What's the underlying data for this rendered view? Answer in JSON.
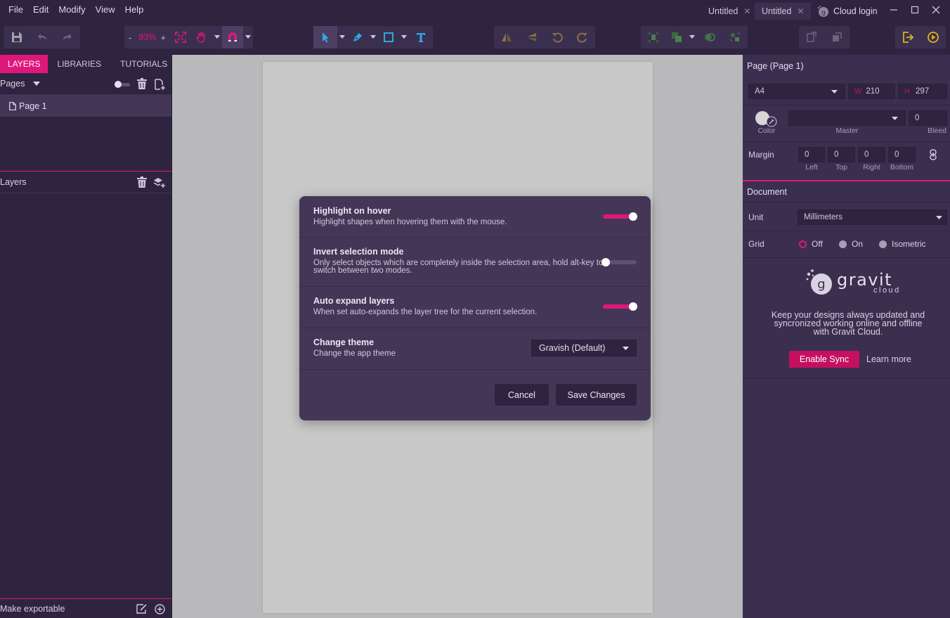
{
  "menubar": {
    "items": [
      "File",
      "Edit",
      "Modify",
      "View",
      "Help"
    ],
    "tabs": [
      {
        "label": "Untitled",
        "active": false
      },
      {
        "label": "Untitled",
        "active": true
      }
    ],
    "cloud_login": "Cloud login"
  },
  "toolbar": {
    "zoom_minus": "-",
    "zoom_value": "93%",
    "zoom_plus": "+"
  },
  "left_panel": {
    "tabs": [
      "LAYERS",
      "LIBRARIES",
      "TUTORIALS"
    ],
    "pages_label": "Pages",
    "page_items": [
      "Page 1"
    ],
    "layers_label": "Layers",
    "footer_label": "Make exportable"
  },
  "dialog": {
    "settings": [
      {
        "title": "Highlight on hover",
        "description": "Highlight shapes when hovering them with the mouse.",
        "enabled": true
      },
      {
        "title": "Invert selection mode",
        "description_line1": "Only select objects which are completely inside the selection area, hold alt-key to",
        "description_line2": "switch between two modes.",
        "enabled": false
      },
      {
        "title": "Auto expand layers",
        "description": "When set auto-expands the layer tree for the current selection.",
        "enabled": true
      },
      {
        "title": "Change theme",
        "description": "Change the app theme"
      }
    ],
    "theme_value": "Gravish (Default)",
    "cancel_label": "Cancel",
    "save_label": "Save Changes"
  },
  "right_panel": {
    "page_header": "Page (Page 1)",
    "size_preset": "A4",
    "width_label": "W",
    "width_value": "210",
    "height_label": "H",
    "height_value": "297",
    "color_label": "Color",
    "master_label": "Master",
    "master_value": "",
    "bleed_label": "Bleed",
    "bleed_value": "0",
    "margin_label": "Margin",
    "margins": [
      {
        "label": "Left",
        "value": "0"
      },
      {
        "label": "Top",
        "value": "0"
      },
      {
        "label": "Right",
        "value": "0"
      },
      {
        "label": "Bottom",
        "value": "0"
      }
    ],
    "document_header": "Document",
    "unit_label": "Unit",
    "unit_value": "Millimeters",
    "grid_label": "Grid",
    "grid_options": [
      "Off",
      "On",
      "Isometric"
    ],
    "grid_selected": "Off",
    "gravit_brand": "gravit",
    "gravit_sub": "cloud",
    "cloud_text_line1": "Keep your designs always updated and",
    "cloud_text_line2": "syncronized working online and offline",
    "cloud_text_line3": "with Gravit Cloud.",
    "enable_sync_label": "Enable Sync",
    "learn_more_label": "Learn more"
  },
  "colors": {
    "accent": "#e0177a",
    "panel_bg": "#2f2440",
    "panel_bg_light": "#3b2f4f",
    "dialog_bg": "#433657",
    "canvas_bg": "#b9b9bc",
    "page_bg": "#c8c8c8"
  }
}
